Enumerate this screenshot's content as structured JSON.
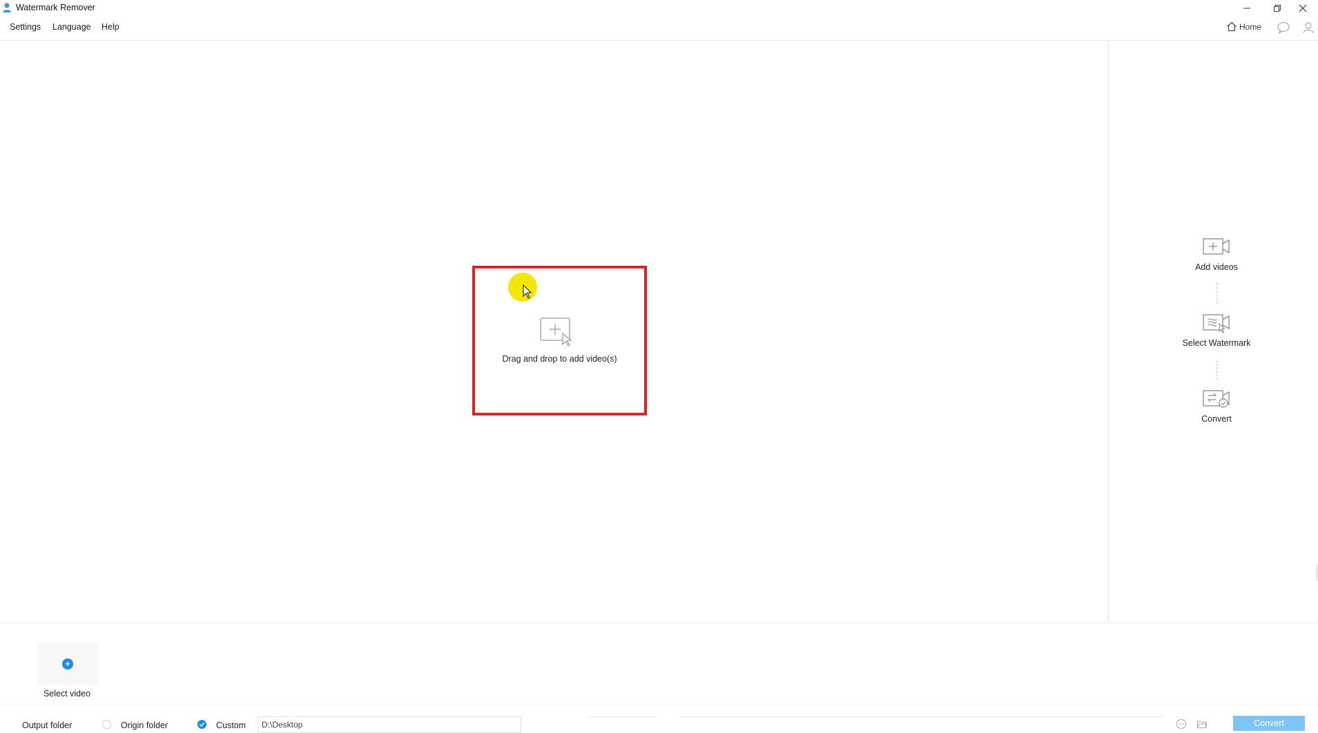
{
  "app": {
    "title": "Watermark Remover"
  },
  "menu": {
    "settings": "Settings",
    "language": "Language",
    "help": "Help"
  },
  "top_right": {
    "home": "Home"
  },
  "drop_zone": {
    "text": "Drag and drop to add video(s)"
  },
  "steps": [
    {
      "label": "Add videos",
      "icon": "add-video-icon"
    },
    {
      "label": "Select Watermark",
      "icon": "select-watermark-icon"
    },
    {
      "label": "Convert",
      "icon": "convert-icon"
    }
  ],
  "bottom": {
    "select_video": "Select video",
    "output_folder_label": "Output folder",
    "origin_folder_label": "Origin folder",
    "custom_label": "Custom",
    "path_value": "D:\\Desktop",
    "selected_option": "Custom",
    "convert_button": "Convert"
  },
  "colors": {
    "accent": "#1e88e5",
    "highlight_border": "#d9242a",
    "convert_button": "#7fc4f5",
    "cursor_highlight": "#f3e600"
  }
}
